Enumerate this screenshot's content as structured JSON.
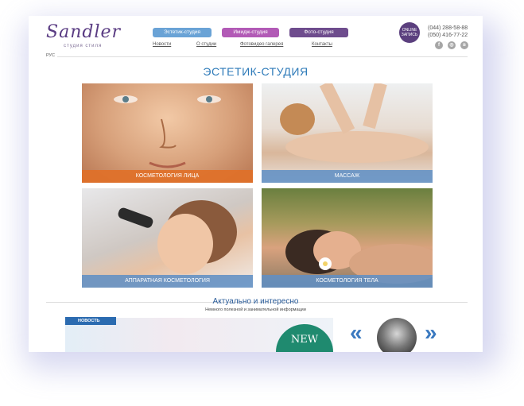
{
  "header": {
    "logo_text": "Sandler",
    "logo_sub": "студия стиля",
    "pills": [
      "Эстетик-студия",
      "Имидж-студия",
      "Фото-студия"
    ],
    "nav": [
      "Новости",
      "О студии",
      "Фотовидео галерея",
      "Контакты"
    ],
    "online_badge": [
      "ONLINE",
      "ЗАПИСЬ"
    ],
    "phones": [
      "(044) 288-58-88",
      "(050) 416-77-22"
    ],
    "social": [
      {
        "icon": "facebook-icon",
        "glyph": "f"
      },
      {
        "icon": "instagram-icon",
        "glyph": "◎"
      },
      {
        "icon": "vk-icon",
        "glyph": "в"
      }
    ],
    "language": "РУС"
  },
  "page_title": "ЭСТЕТИК-СТУДИЯ",
  "tiles": [
    {
      "label": "КОСМЕТОЛОГИЯ ЛИЦА"
    },
    {
      "label": "МАССАЖ"
    },
    {
      "label": "АППАРАТНАЯ КОСМЕТОЛОГИЯ"
    },
    {
      "label": "КОСМЕТОЛОГИЯ ТЕЛА"
    }
  ],
  "news_section": {
    "title": "Актуально и интересно",
    "subtitle": "Немного полезной и занимательной информации",
    "badge": "НОВОСТЬ",
    "new_badge": "NEW"
  },
  "carousel": {
    "prev": "«",
    "next": "»"
  },
  "colors": {
    "accent_blue": "#2d7ab9",
    "pill_blue": "#6aa3d6",
    "pill_pink": "#b25ab6",
    "pill_purple": "#6e4c8d",
    "orange_label": "#df7028",
    "brand_purple": "#5b3f7e"
  }
}
